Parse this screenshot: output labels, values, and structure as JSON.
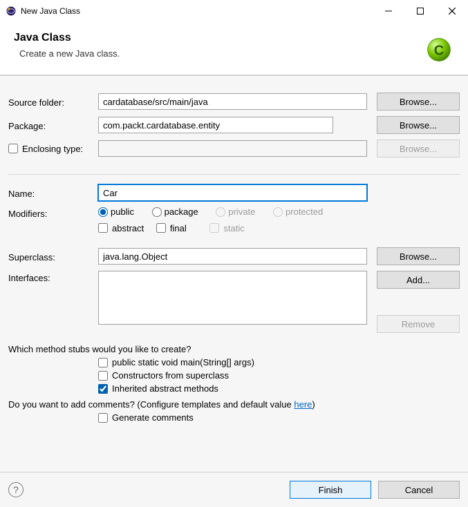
{
  "window": {
    "title": "New Java Class"
  },
  "header": {
    "title": "Java Class",
    "subtitle": "Create a new Java class."
  },
  "labels": {
    "sourceFolder": "Source folder:",
    "package": "Package:",
    "enclosingType": "Enclosing type:",
    "name": "Name:",
    "modifiers": "Modifiers:",
    "superclass": "Superclass:",
    "interfaces": "Interfaces:",
    "stubsQuestion": "Which method stubs would you like to create?",
    "commentsQuestionPrefix": "Do you want to add comments? (Configure templates and default value ",
    "commentsLinkText": "here",
    "commentsQuestionSuffix": ")"
  },
  "fields": {
    "sourceFolder": "cardatabase/src/main/java",
    "package": "com.packt.cardatabase.entity",
    "enclosingType": "",
    "name": "Car",
    "superclass": "java.lang.Object"
  },
  "modifiers": {
    "radios": {
      "public": "public",
      "package": "package",
      "private": "private",
      "protected": "protected"
    },
    "checks": {
      "abstract": "abstract",
      "final": "final",
      "static": "static"
    }
  },
  "stubs": {
    "main": "public static void main(String[] args)",
    "constructors": "Constructors from superclass",
    "inherited": "Inherited abstract methods"
  },
  "comments": {
    "generate": "Generate comments"
  },
  "buttons": {
    "browse": "Browse...",
    "add": "Add...",
    "remove": "Remove",
    "finish": "Finish",
    "cancel": "Cancel"
  }
}
